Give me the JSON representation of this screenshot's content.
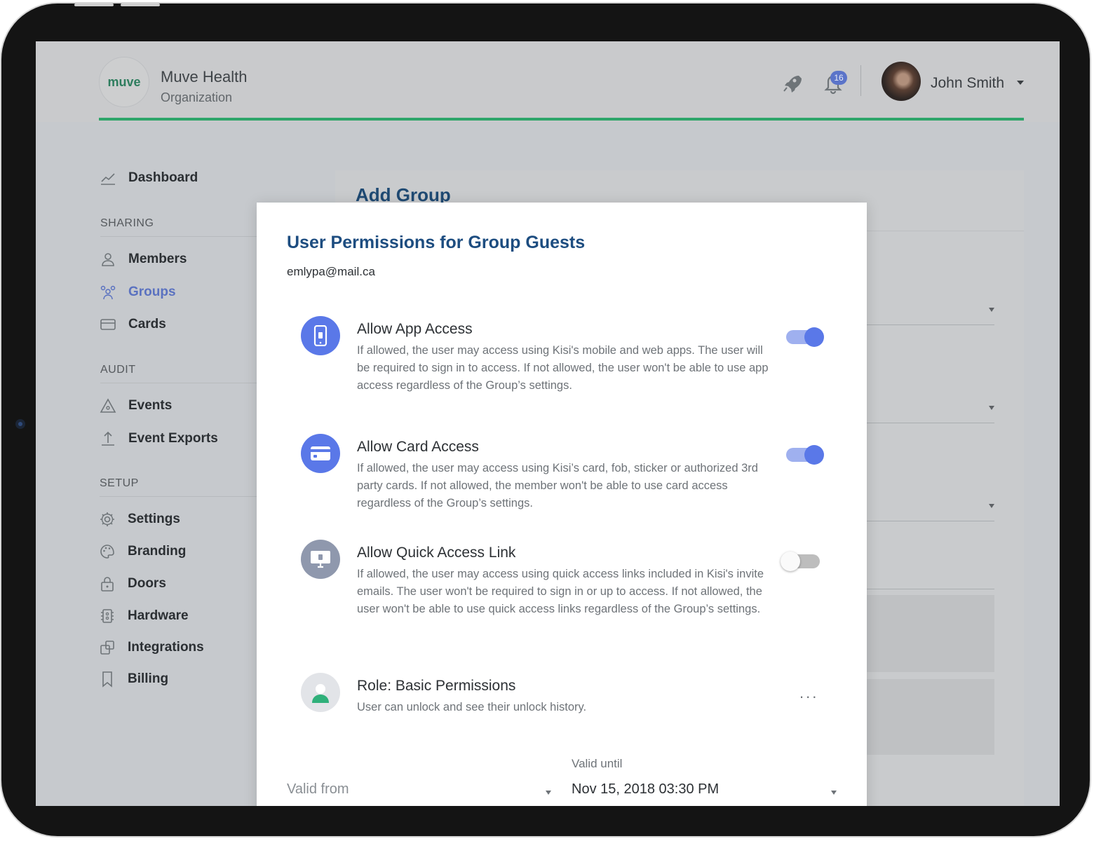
{
  "header": {
    "org_name": "Muve Health",
    "org_subtitle": "Organization",
    "logo_text": "muve",
    "notification_count": "16",
    "user_name": "John Smith",
    "accent_color": "#2ea56a"
  },
  "sidebar": {
    "dashboard": "Dashboard",
    "sections": {
      "sharing": "SHARING",
      "audit": "AUDIT",
      "setup": "SETUP"
    },
    "items": {
      "members": "Members",
      "groups": "Groups",
      "cards": "Cards",
      "events": "Events",
      "event_exports": "Event Exports",
      "settings": "Settings",
      "branding": "Branding",
      "doors": "Doors",
      "hardware": "Hardware",
      "integrations": "Integrations",
      "billing": "Billing"
    },
    "active_item": "Groups",
    "active_color": "#5b72c0"
  },
  "background": {
    "card_title": "Add Group"
  },
  "modal": {
    "title": "User Permissions for Group Guests",
    "email": "emlypa@mail.ca",
    "permissions": [
      {
        "title": "Allow App Access",
        "description": "If allowed, the user may access using Kisi's mobile and web apps. The user will be required to sign in to access. If not allowed, the user won't be able to use app access regardless of the Group’s settings.",
        "enabled": true,
        "icon": "phone-icon"
      },
      {
        "title": "Allow Card Access",
        "description": "If allowed, the user may access using Kisi’s card, fob, sticker or authorized 3rd party cards. If not allowed, the member won't be able to use card access regardless of the Group’s settings.",
        "enabled": true,
        "icon": "card-icon"
      },
      {
        "title": "Allow Quick Access Link",
        "description": "If allowed, the user may access using quick access links included in Kisi's invite emails. The user won't be required to sign in or up to access. If not allowed, the user won't be able to use quick access links regardless of the Group’s settings.",
        "enabled": false,
        "icon": "monitor-icon"
      }
    ],
    "role": {
      "title": "Role: Basic Permissions",
      "description": "User can unlock and see their unlock history.",
      "menu_label": "..."
    },
    "valid_from": {
      "placeholder": "Valid from"
    },
    "valid_until": {
      "label": "Valid until",
      "value": "Nov 15, 2018 03:30 PM"
    },
    "toggle_on_color": "#5a78e8",
    "icon_color": "#5a78e8"
  }
}
